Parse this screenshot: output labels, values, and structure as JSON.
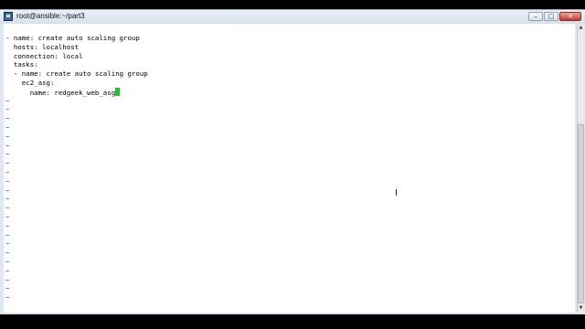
{
  "window": {
    "title": "root@ansible:~/part3",
    "minimize_label": "–",
    "maximize_label": "□",
    "close_label": "✕"
  },
  "editor": {
    "lines": [
      "- name: create auto scaling group",
      "  hosts: localhost",
      "  connection: local",
      "  tasks:",
      "  - name: create auto scaling group",
      "    ec2_asg:",
      "      name: redgeek_web_asg"
    ],
    "empty_line_marker": "~",
    "empty_line_count": 23
  },
  "scrollbar": {
    "up_arrow": "▲",
    "down_arrow": "▼"
  },
  "cursor_glyph": "I",
  "colors": {
    "terminal_bg": "#ffffff",
    "text": "#000000",
    "tilde": "#2a44c8",
    "cursor": "#19c919",
    "titlebar": "#dfe7f1",
    "close_button": "#c4392b"
  },
  "icons": {
    "app": "putty-terminal-icon",
    "minimize": "minimize-icon",
    "maximize": "maximize-icon",
    "close": "close-icon",
    "pointer": "text-ibeam-icon"
  }
}
